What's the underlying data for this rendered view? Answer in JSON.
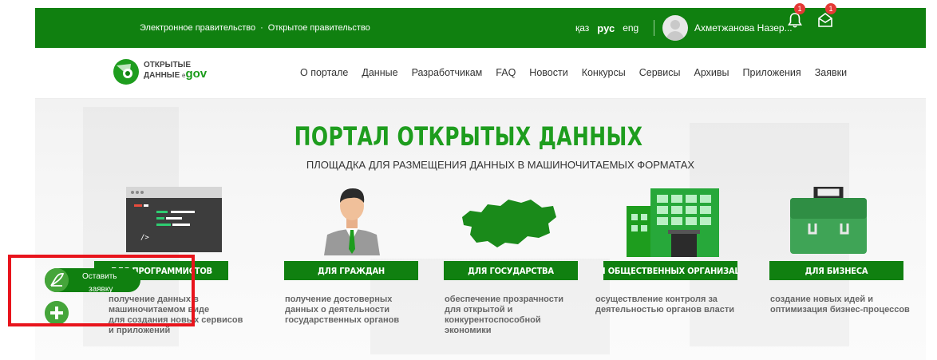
{
  "header": {
    "e_gov": "Электронное правительство",
    "separator": "·",
    "open_gov": "Открытое правительство",
    "languages": [
      "қаз",
      "рус",
      "eng"
    ],
    "active_language": "рус",
    "username": "Ахметжанова Назер...",
    "notifications_count": "1",
    "messages_count": "1"
  },
  "logo": {
    "line1": "ОТКРЫТЫЕ",
    "line2": "ДАННЫЕ",
    "e": "e",
    "gov": "gov"
  },
  "nav": {
    "items": [
      "О портале",
      "Данные",
      "Разработчикам",
      "FAQ",
      "Новости",
      "Конкурсы",
      "Сервисы",
      "Архивы",
      "Приложения",
      "Заявки"
    ]
  },
  "hero": {
    "title": "ПОРТАЛ ОТКРЫТЫХ ДАННЫХ",
    "subtitle": "ПЛОЩАДКА ДЛЯ РАЗМЕЩЕНИЯ ДАННЫХ В МАШИНОЧИТАЕМЫХ ФОРМАТАХ"
  },
  "categories": [
    {
      "label": "ДЛЯ ПРОГРАММИСТОВ",
      "desc": [
        "получение данных в",
        "машиночитаемом виде",
        "для создания новых сервисов",
        "и приложений"
      ],
      "icon": "code-window-icon"
    },
    {
      "label": "ДЛЯ ГРАЖДАН",
      "desc": [
        "получение достоверных",
        "данных о деятельности",
        "государственных органов"
      ],
      "icon": "citizen-icon"
    },
    {
      "label": "ДЛЯ ГОСУДАРСТВА",
      "desc": [
        "обеспечение прозрачности",
        "для открытой и",
        "конкурентоспособной",
        "экономики"
      ],
      "icon": "kazakhstan-map-icon"
    },
    {
      "label": "ДЛЯ ОБЩЕСТВЕННЫХ ОРГАНИЗАЦИЙ",
      "desc": [
        "осуществление контроля за",
        "деятельностью органов власти"
      ],
      "icon": "building-icon"
    },
    {
      "label": "ДЛЯ БИЗНЕСА",
      "desc": [
        "создание новых идей и",
        "оптимизация бизнес-процессов"
      ],
      "icon": "briefcase-icon"
    }
  ],
  "widget": {
    "leave_request_line1": "Оставить",
    "leave_request_line2": "заявку"
  },
  "colors": {
    "brand_green": "#108010",
    "accent_green": "#1e9d1e",
    "highlight_red": "#e8141c",
    "badge_red": "#e53935"
  }
}
